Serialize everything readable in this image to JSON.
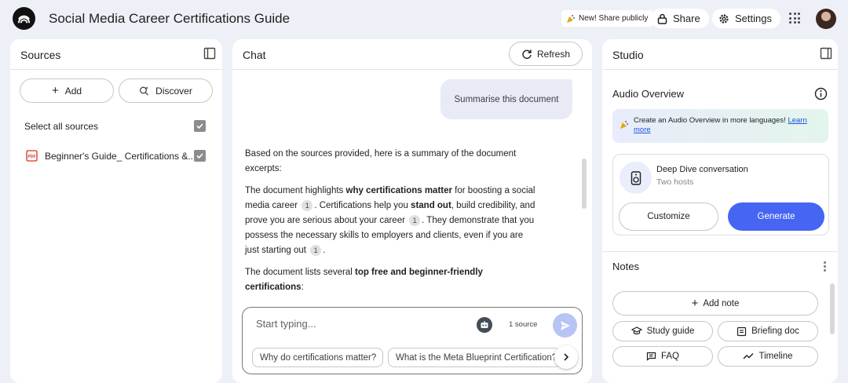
{
  "header": {
    "title": "Social Media Career Certifications Guide",
    "share_public_label": "New! Share publicly",
    "share_label": "Share",
    "settings_label": "Settings"
  },
  "sources": {
    "title": "Sources",
    "add_label": "Add",
    "discover_label": "Discover",
    "select_all_label": "Select all sources",
    "items": [
      {
        "label": "Beginner's Guide_ Certifications &...",
        "type": "PDF",
        "checked": true
      }
    ]
  },
  "chat": {
    "title": "Chat",
    "refresh_label": "Refresh",
    "user_message": "Summarise this document",
    "answer": {
      "p1": "Based on the sources provided, here is a summary of the document excerpts:",
      "p2_a": "The document highlights ",
      "p2_b": "why certifications matter",
      "p2_c": " for boosting a social media career ",
      "p2_d": ". Certifications help you ",
      "p2_e": "stand out",
      "p2_f": ", build credibility, and prove you are serious about your career ",
      "p2_g": ". They demonstrate that you possess the necessary skills to employers and clients, even if you are just starting out ",
      "p2_h": ".",
      "p3_a": "The document lists several ",
      "p3_b": "top free and beginner-friendly certifications",
      "p3_c": ":",
      "citation": "1"
    },
    "input_placeholder": "Start typing...",
    "source_count": "1 source",
    "suggestions": [
      "Why do certifications matter?",
      "What is the Meta Blueprint Certification?"
    ]
  },
  "studio": {
    "title": "Studio",
    "audio_overview_title": "Audio Overview",
    "banner_text": "Create an Audio Overview in more languages! ",
    "banner_link": "Learn more",
    "deep_dive_title": "Deep Dive conversation",
    "deep_dive_sub": "Two hosts",
    "customize_label": "Customize",
    "generate_label": "Generate",
    "notes_title": "Notes",
    "add_note_label": "Add note",
    "study_guide_label": "Study guide",
    "briefing_doc_label": "Briefing doc",
    "faq_label": "FAQ",
    "timeline_label": "Timeline"
  },
  "colors": {
    "background": "#eef0f8",
    "accent": "#4565f2",
    "send_button": "#b7c4f4"
  }
}
